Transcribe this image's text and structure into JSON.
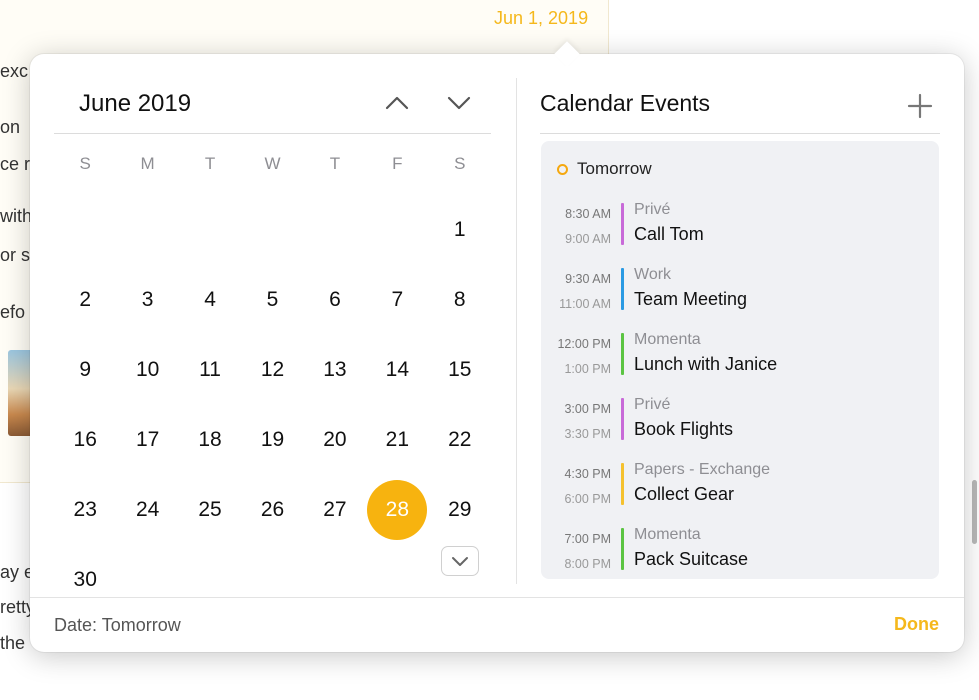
{
  "background": {
    "date_label": "Jun 1, 2019",
    "fragments": [
      "exc",
      "on",
      "ce r",
      "with",
      "or s",
      "efo",
      "ay e",
      "retty",
      "the"
    ]
  },
  "calendar": {
    "month_title": "June 2019",
    "weekdays": [
      "S",
      "M",
      "T",
      "W",
      "T",
      "F",
      "S"
    ],
    "leading_blanks": 6,
    "days": [
      "1",
      "2",
      "3",
      "4",
      "5",
      "6",
      "7",
      "8",
      "9",
      "10",
      "11",
      "12",
      "13",
      "14",
      "15",
      "16",
      "17",
      "18",
      "19",
      "20",
      "21",
      "22",
      "23",
      "24",
      "25",
      "26",
      "27",
      "28",
      "29",
      "30"
    ],
    "selected_day": "28"
  },
  "events": {
    "title": "Calendar Events",
    "day_label": "Tomorrow",
    "items": [
      {
        "start": "8:30 AM",
        "end": "9:00 AM",
        "calendar": "Privé",
        "name": "Call Tom",
        "color": "#c86ad8"
      },
      {
        "start": "9:30 AM",
        "end": "11:00 AM",
        "calendar": "Work",
        "name": "Team Meeting",
        "color": "#2a9ae3"
      },
      {
        "start": "12:00 PM",
        "end": "1:00 PM",
        "calendar": "Momenta",
        "name": "Lunch with Janice",
        "color": "#5bc442"
      },
      {
        "start": "3:00 PM",
        "end": "3:30 PM",
        "calendar": "Privé",
        "name": "Book Flights",
        "color": "#c86ad8"
      },
      {
        "start": "4:30 PM",
        "end": "6:00 PM",
        "calendar": "Papers - Exchange",
        "name": "Collect Gear",
        "color": "#f5c12e"
      },
      {
        "start": "7:00 PM",
        "end": "8:00 PM",
        "calendar": "Momenta",
        "name": "Pack Suitcase",
        "color": "#5bc442"
      }
    ]
  },
  "footer": {
    "date_text": "Date: Tomorrow",
    "done_label": "Done"
  },
  "colors": {
    "accent": "#f7b30f",
    "selected_day": "#f7b30f"
  },
  "icons": {
    "prev_month": "chevron-up-icon",
    "next_month": "chevron-down-icon",
    "add_event": "plus-icon",
    "expand": "chevron-down-icon",
    "day_marker": "ring-icon"
  }
}
